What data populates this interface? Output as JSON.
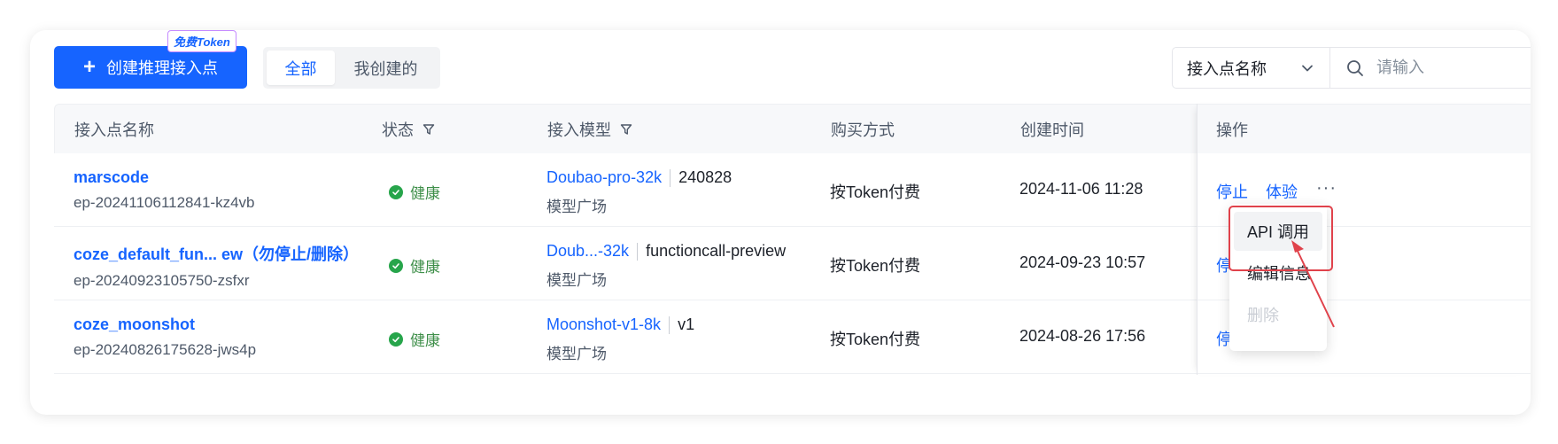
{
  "toolbar": {
    "create_label": "创建推理接入点",
    "token_badge": "免费Token",
    "segment": {
      "all": "全部",
      "mine": "我创建的"
    },
    "filter_select": "接入点名称",
    "search_placeholder": "请输入"
  },
  "table": {
    "headers": {
      "name": "接入点名称",
      "status": "状态",
      "model": "接入模型",
      "purchase": "购买方式",
      "created": "创建时间",
      "actions": "操作"
    },
    "rows": [
      {
        "name": "marscode",
        "id": "ep-20241106112841-kz4vb",
        "status": "健康",
        "model": "Doubao-pro-32k",
        "version": "240828",
        "source": "模型广场",
        "purchase": "按Token付费",
        "created": "2024-11-06 11:28",
        "stop": "停止",
        "try": "体验"
      },
      {
        "name": "coze_default_fun... ew（勿停止/删除）",
        "id": "ep-20240923105750-zsfxr",
        "status": "健康",
        "model": "Doub...-32k",
        "version": "functioncall-preview",
        "source": "模型广场",
        "purchase": "按Token付费",
        "created": "2024-09-23 10:57",
        "stop": "停"
      },
      {
        "name": "coze_moonshot",
        "id": "ep-20240826175628-jws4p",
        "status": "健康",
        "model": "Moonshot-v1-8k",
        "version": "v1",
        "source": "模型广场",
        "purchase": "按Token付费",
        "created": "2024-08-26 17:56",
        "stop": "停..."
      }
    ]
  },
  "dropdown": {
    "items": [
      "API 调用",
      "编辑信息",
      "删除"
    ]
  },
  "colors": {
    "primary": "#1664ff",
    "healthy": "#27a54b",
    "highlight": "#e0424b"
  }
}
